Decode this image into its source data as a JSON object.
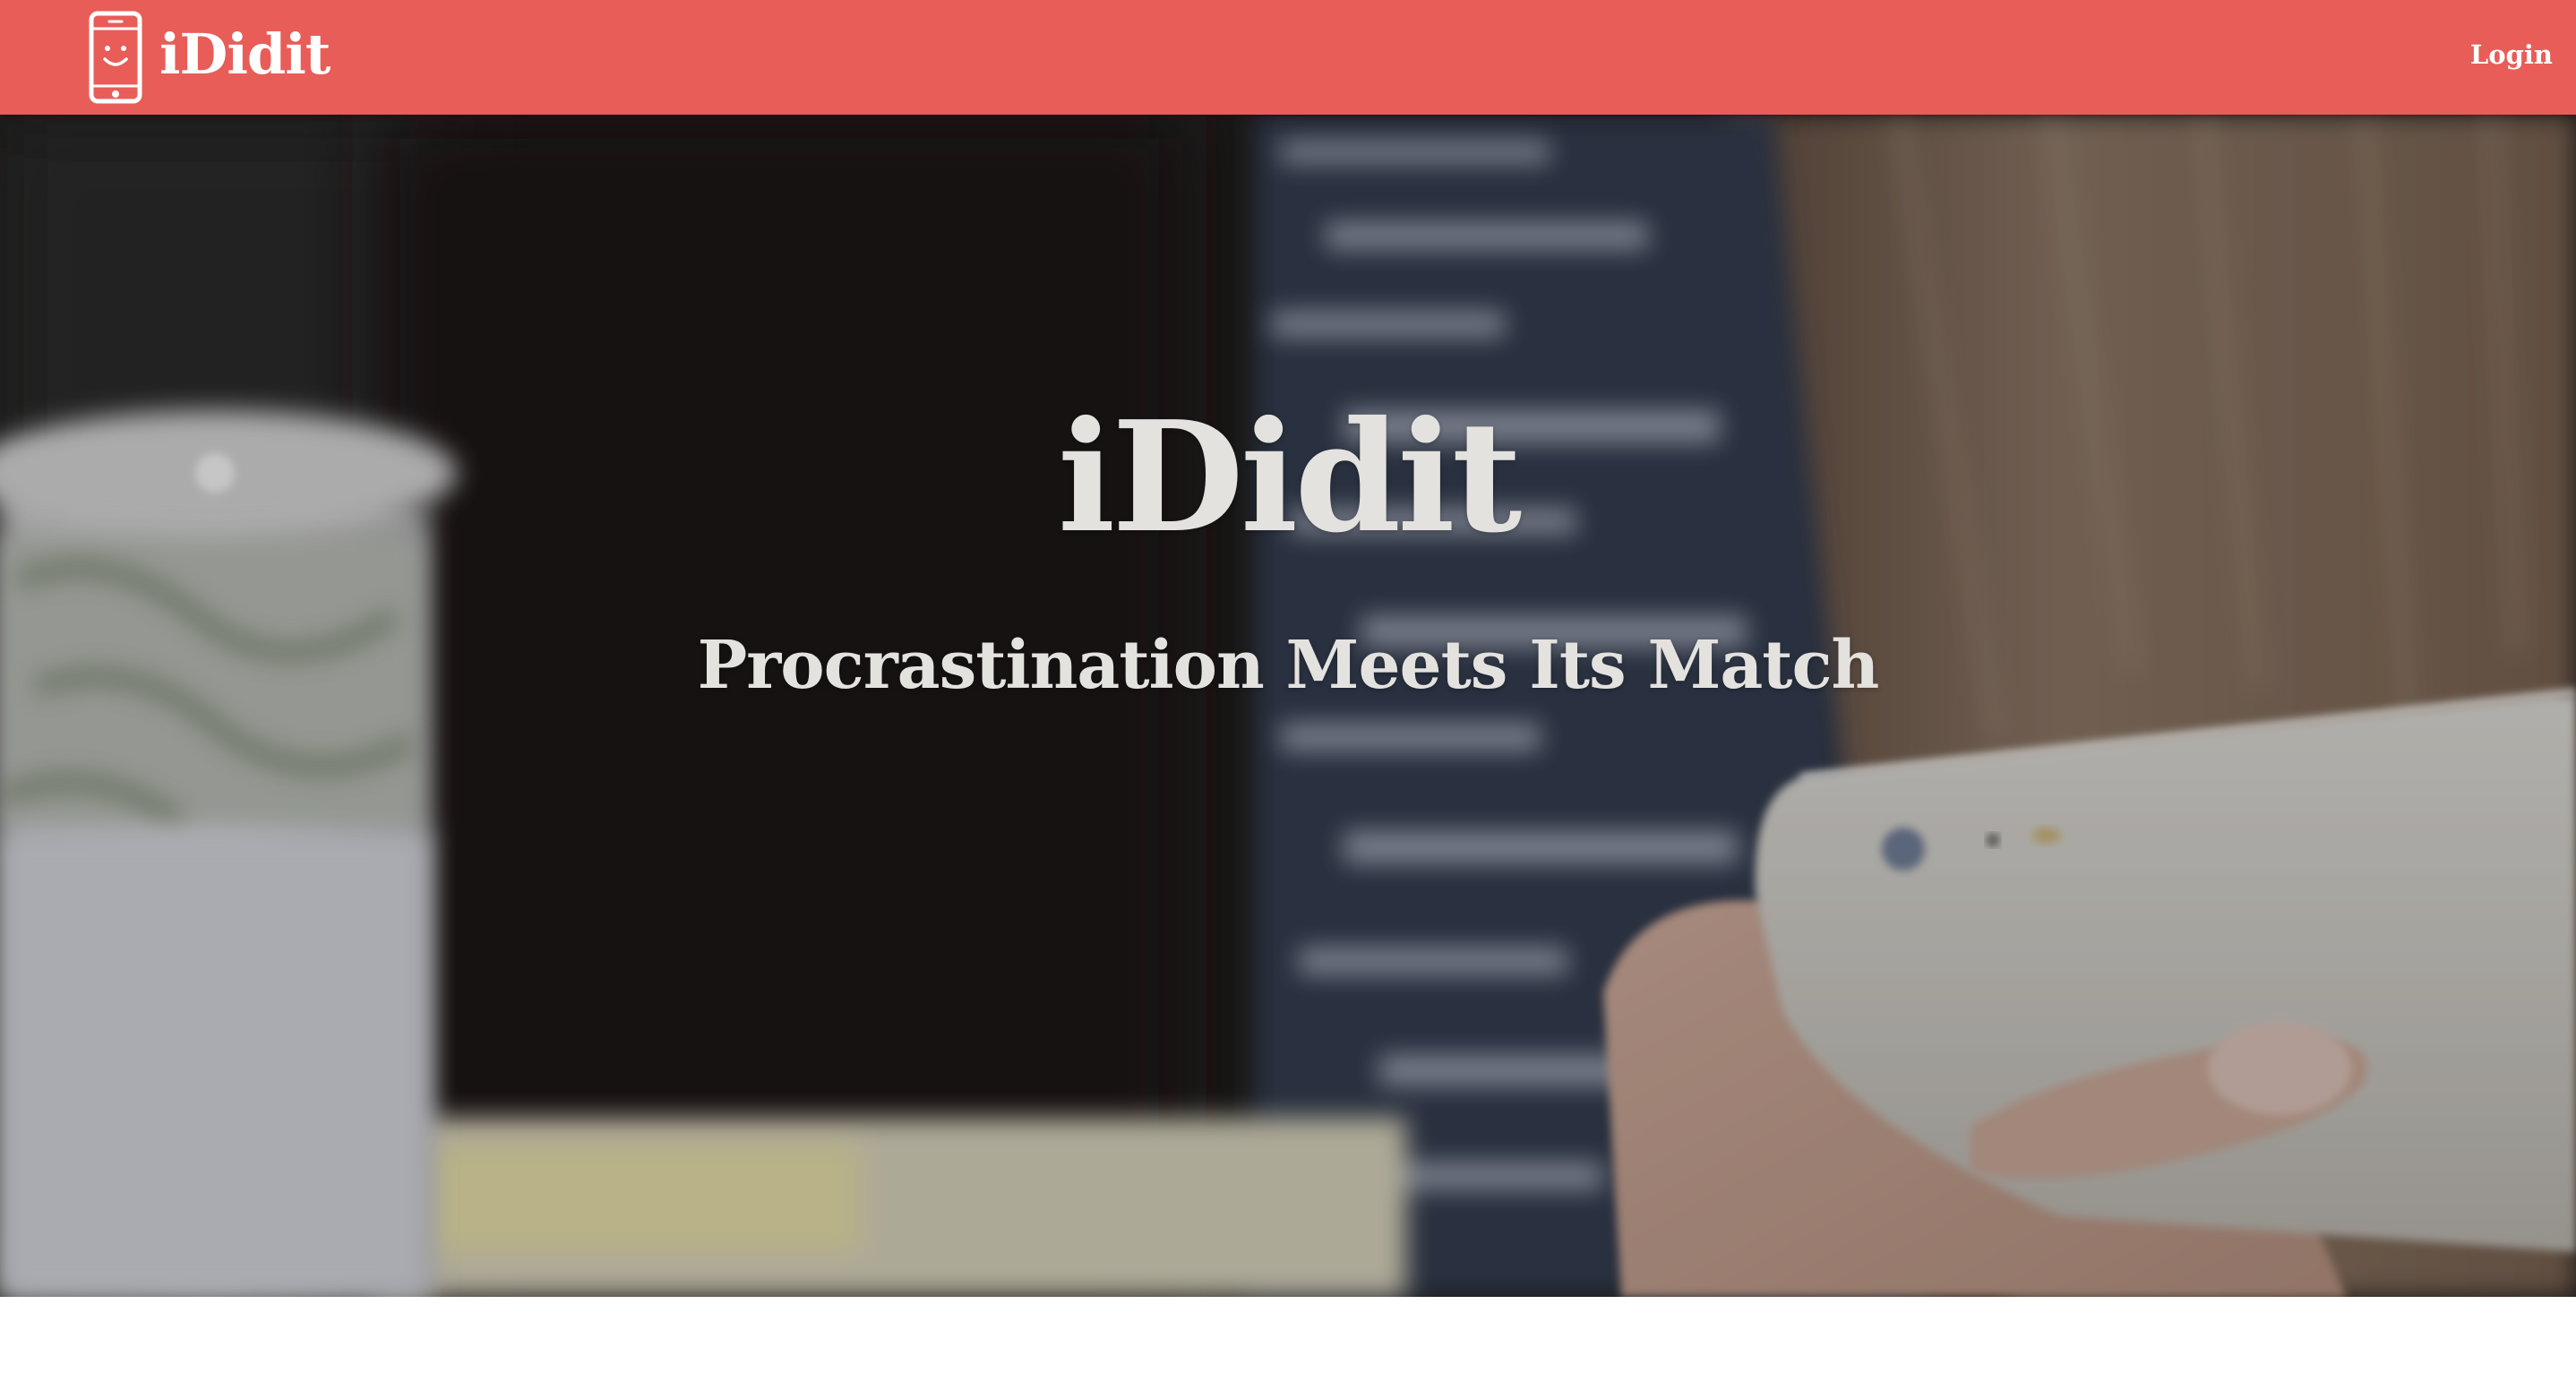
{
  "navbar": {
    "brand_name": "iDidit",
    "brand_icon": "smiling-phone-icon",
    "login_label": "Login",
    "background_color": "#e85d58"
  },
  "hero": {
    "title": "iDidit",
    "subtitle": "Procrastination Meets Its Match",
    "text_color": "#e4e2df"
  }
}
